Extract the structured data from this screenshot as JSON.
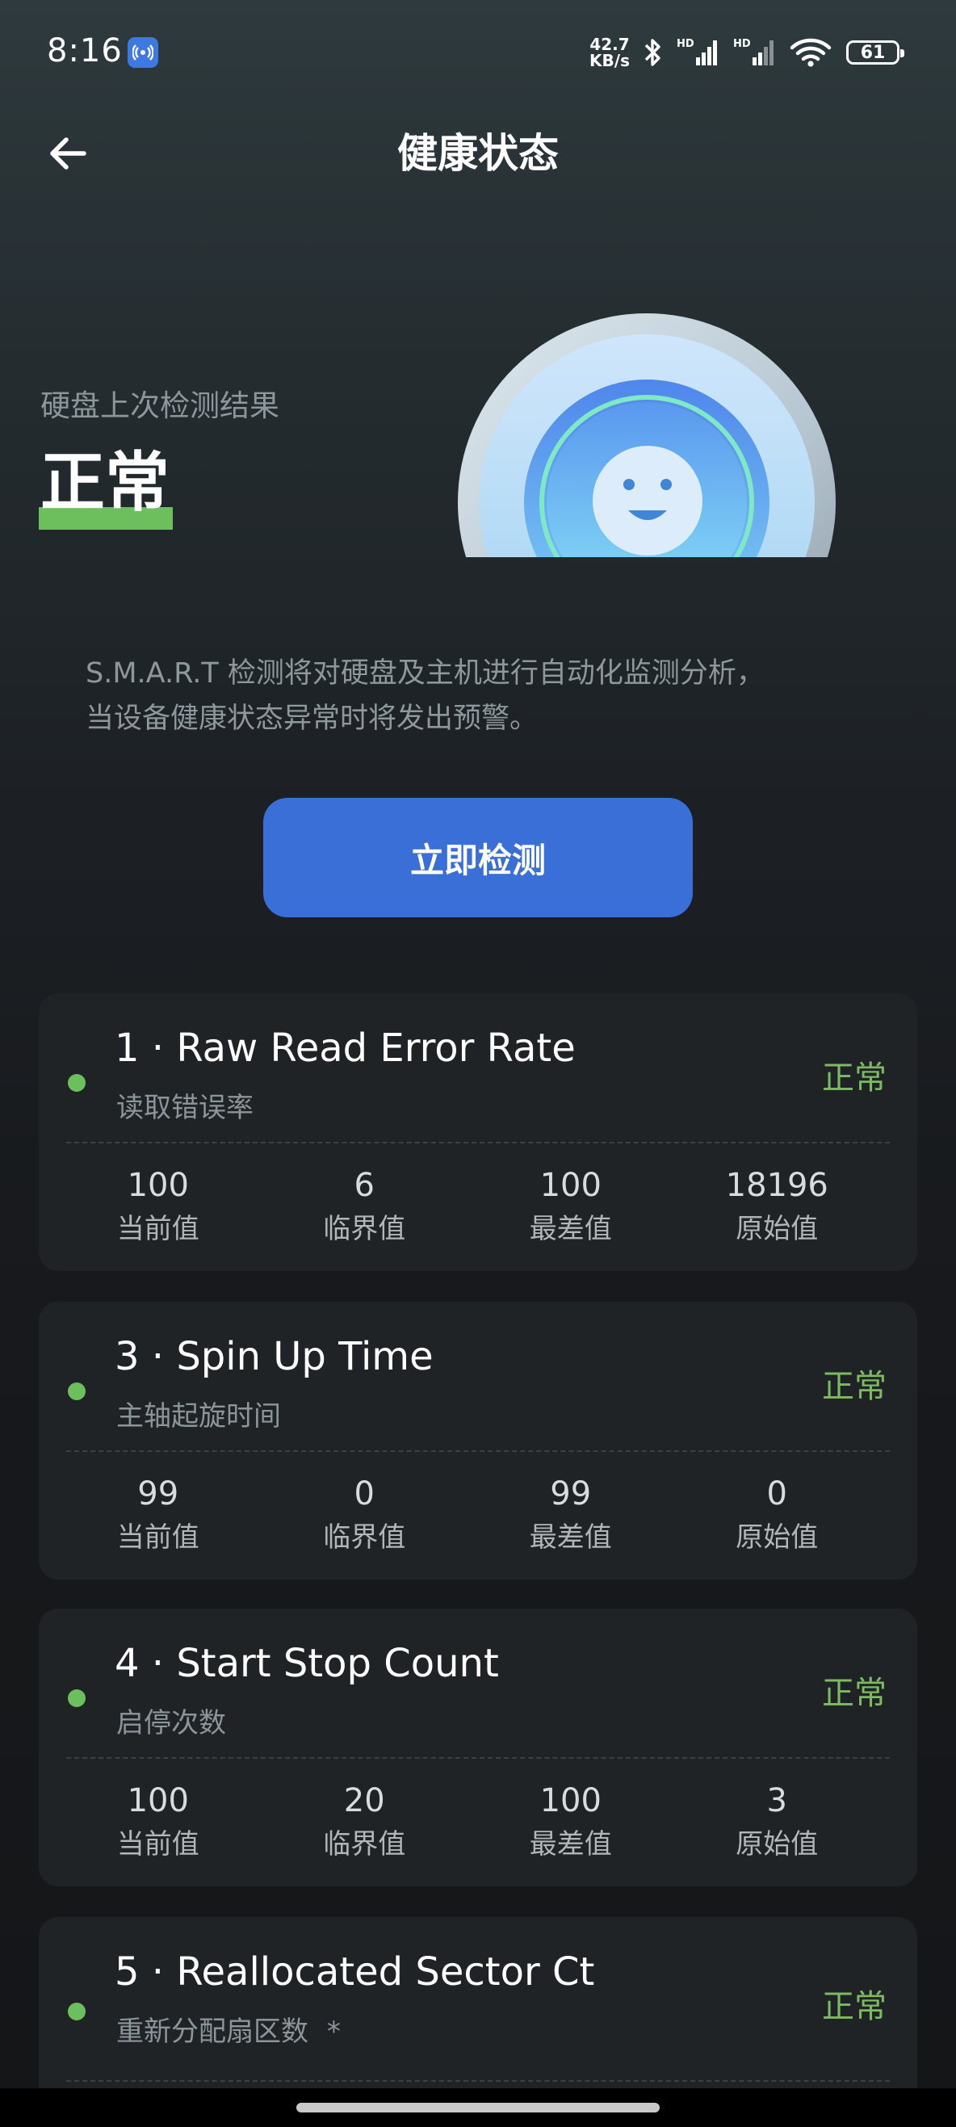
{
  "status_bar": {
    "time": "8:16",
    "notification_icon": "hotspot-icon",
    "net_speed_value": "42.7",
    "net_speed_unit": "KB/s",
    "battery": "61",
    "icons": [
      "bluetooth-icon",
      "signal-hd-icon",
      "signal-hd-icon",
      "wifi-icon",
      "battery-icon"
    ]
  },
  "header": {
    "title": "健康状态",
    "back_icon": "arrow-left-icon"
  },
  "hero": {
    "caption": "硬盘上次检测结果",
    "status": "正常",
    "illustration": "smiley-dome-icon"
  },
  "description": {
    "line1": "S.M.A.R.T 检测将对硬盘及主机进行自动化监测分析，",
    "line2": "当设备健康状态异常时将发出预警。"
  },
  "check_button": {
    "label": "立即检测"
  },
  "stat_labels": {
    "current": "当前值",
    "threshold": "临界值",
    "worst": "最差值",
    "raw": "原始值"
  },
  "attributes": [
    {
      "title": "1 · Raw Read Error Rate",
      "subtitle": "读取错误率",
      "status": "正常",
      "current": "100",
      "threshold": "6",
      "worst": "100",
      "raw": "18196"
    },
    {
      "title": "3 · Spin Up Time",
      "subtitle": "主轴起旋时间",
      "status": "正常",
      "current": "99",
      "threshold": "0",
      "worst": "99",
      "raw": "0"
    },
    {
      "title": "4 · Start Stop Count",
      "subtitle": "启停次数",
      "status": "正常",
      "current": "100",
      "threshold": "20",
      "worst": "100",
      "raw": "3"
    },
    {
      "title": "5 · Reallocated Sector Ct",
      "subtitle": "重新分配扇区数",
      "subtitle_mark": "*",
      "status": "正常"
    }
  ],
  "colors": {
    "accent_blue": "#3a6fd8",
    "ok_green": "#6cbf5c",
    "card_bg": "#202326"
  }
}
